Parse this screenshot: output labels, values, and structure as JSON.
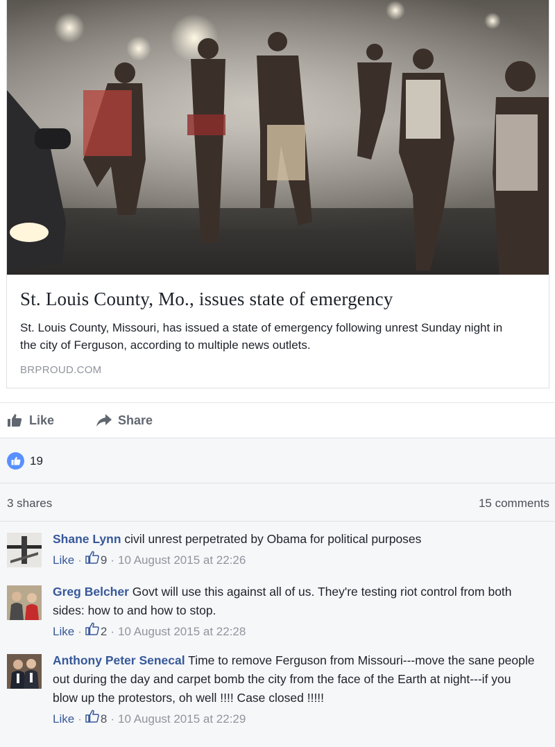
{
  "card": {
    "title": "St. Louis County, Mo., issues state of emergency",
    "description": "St. Louis County, Missouri, has issued a state of emergency following unrest Sunday night in the city of Ferguson, according to multiple news outlets.",
    "domain": "BRPROUD.COM"
  },
  "actions": {
    "like_label": "Like",
    "share_label": "Share"
  },
  "stats": {
    "reaction_count": "19",
    "shares": "3 shares",
    "comments": "15 comments"
  },
  "comments": [
    {
      "name": "Shane Lynn",
      "text": "civil unrest perpetrated by Obama for political purposes",
      "like_label": "Like",
      "separator": "·",
      "likes": "9",
      "timestamp": "10 August 2015 at 22:26"
    },
    {
      "name": "Greg Belcher",
      "text": "Govt will use this against all of us. They're testing riot control from both sides: how to and how to stop.",
      "like_label": "Like",
      "separator": "·",
      "likes": "2",
      "timestamp": "10 August 2015 at 22:28"
    },
    {
      "name": "Anthony Peter Senecal",
      "text": "Time to remove Ferguson from Missouri---move the sane people out during the day and carpet bomb the city from the face of the Earth at night---if you blow up the protestors, oh well !!!! Case closed !!!!!",
      "like_label": "Like",
      "separator": "·",
      "likes": "8",
      "timestamp": "10 August 2015 at 22:29"
    }
  ],
  "icons": {
    "like": "thumbs-up-icon",
    "share": "share-arrow-icon",
    "reaction": "like-reaction-icon"
  },
  "colors": {
    "link_blue": "#365899",
    "reaction_blue": "#5890ff",
    "muted": "#90949c",
    "panel_bg": "#f6f7f9"
  }
}
